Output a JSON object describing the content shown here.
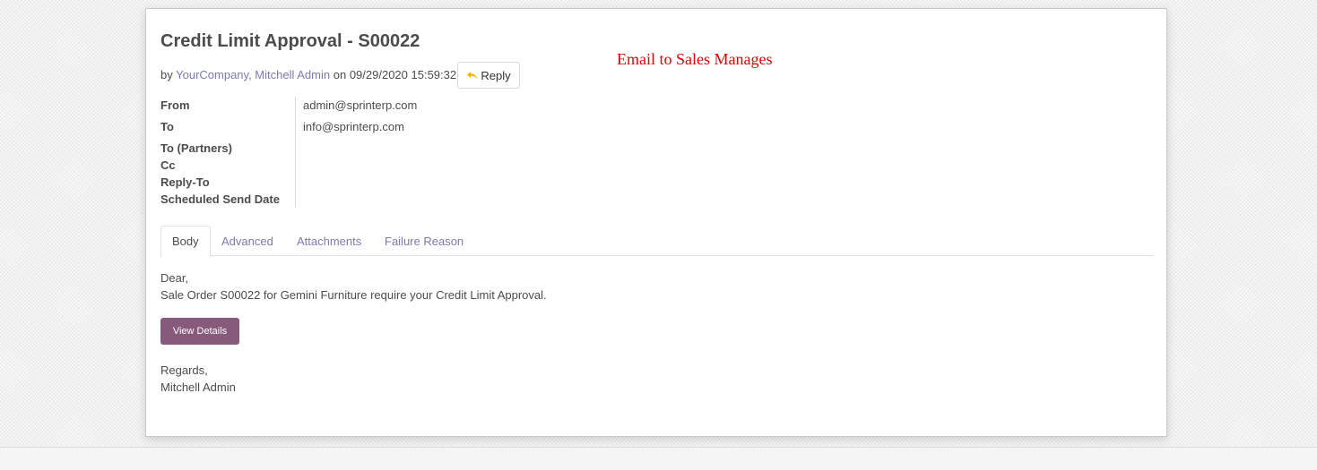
{
  "message": {
    "title": "Credit Limit Approval - S00022",
    "by_prefix": "by",
    "authors": "YourCompany, Mitchell Admin",
    "on_word": "on",
    "date": "09/29/2020 15:59:32",
    "reply_label": "Reply"
  },
  "annotation": "Email to Sales Manages",
  "fields": [
    {
      "label": "From",
      "value": "admin@sprinterp.com"
    },
    {
      "label": "To",
      "value": "info@sprinterp.com"
    },
    {
      "label": "To (Partners)",
      "value": ""
    },
    {
      "label": "Cc",
      "value": ""
    },
    {
      "label": "Reply-To",
      "value": ""
    },
    {
      "label": "Scheduled Send Date",
      "value": ""
    }
  ],
  "tabs": [
    {
      "label": "Body",
      "active": true
    },
    {
      "label": "Advanced",
      "active": false
    },
    {
      "label": "Attachments",
      "active": false
    },
    {
      "label": "Failure Reason",
      "active": false
    }
  ],
  "body": {
    "greeting": "Dear,",
    "line1": "Sale Order S00022 for Gemini Furniture require your Credit Limit Approval.",
    "button_label": "View Details",
    "closing": "Regards,",
    "signature": "Mitchell Admin"
  },
  "colors": {
    "link": "#7c7bad",
    "primary_button": "#875a7b",
    "annotation": "#e00000",
    "reply_icon": "#f0b400"
  },
  "icons": {
    "reply": "reply-arrow-icon"
  }
}
